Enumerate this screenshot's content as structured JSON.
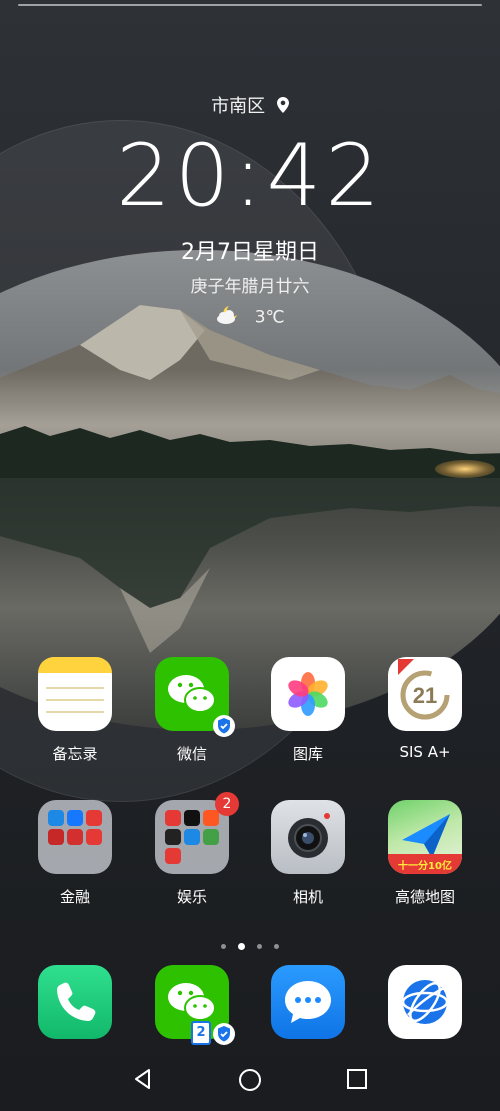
{
  "lockscreen": {
    "location": "市南区",
    "time": "20:42",
    "date": "2月7日星期日",
    "lunar_date": "庚子年腊月廿六",
    "temperature": "3℃",
    "weather_icon": "partly-cloudy-night-icon"
  },
  "apps_row1": [
    {
      "label": "备忘录",
      "icon": "notes-icon"
    },
    {
      "label": "微信",
      "icon": "wechat-icon",
      "verified": true
    },
    {
      "label": "图库",
      "icon": "gallery-icon"
    },
    {
      "label": "SIS A+",
      "icon": "century21-icon"
    }
  ],
  "apps_row2": [
    {
      "label": "金融",
      "icon": "finance-folder-icon"
    },
    {
      "label": "娱乐",
      "icon": "entertainment-folder-icon",
      "badge": "2"
    },
    {
      "label": "相机",
      "icon": "camera-icon"
    },
    {
      "label": "高德地图",
      "icon": "amap-icon",
      "banner": "十一分10亿"
    }
  ],
  "dock": [
    {
      "icon": "phone-icon"
    },
    {
      "icon": "wechat-clone-icon",
      "clone_badge": "2"
    },
    {
      "icon": "messages-icon"
    },
    {
      "icon": "browser-icon"
    }
  ],
  "page_indicator": {
    "pages": 4,
    "active": 2
  },
  "colors": {
    "wechat_green": "#2dc100",
    "phone_green": "#1ed07a",
    "messages_blue": "#1a8cff",
    "badge_red": "#e53935"
  }
}
